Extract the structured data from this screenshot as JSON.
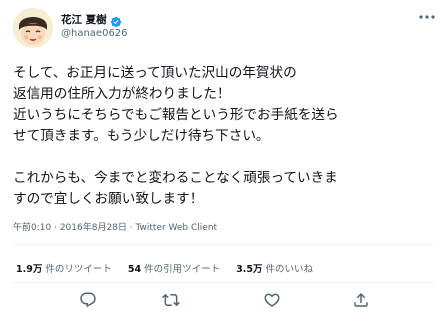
{
  "user": {
    "display_name": "花江 夏樹",
    "handle": "@hanae0626",
    "verified": true
  },
  "tweet": {
    "lines": [
      "そして、お正月に送って頂いた沢山の年賀状の",
      "返信用の住所入力が終わりました！",
      "近いうちにそちらでもご報告という形でお手紙を送ら",
      "せて頂きます。もう少しだけ待ち下さい。",
      "",
      "これからも、今までと変わることなく頑張っていきま",
      "すので宜しくお願い致します！"
    ]
  },
  "meta": {
    "time": "午前0:10",
    "separator": " · ",
    "date": "2016年8月28日",
    "client": "Twitter Web Client"
  },
  "stats": {
    "retweets_num": "1.9万",
    "retweets_label": "件のリツイート",
    "quotes_num": "54",
    "quotes_label": "件の引用ツイート",
    "likes_num": "3.5万",
    "likes_label": "件のいいね"
  },
  "icons": {
    "more": "more-icon",
    "verified": "verified-badge-icon",
    "reply": "reply-icon",
    "retweet": "retweet-icon",
    "like": "like-icon",
    "share": "share-icon"
  },
  "colors": {
    "verified": "#1d9bf0",
    "secondary_text": "#536471",
    "primary_text": "#0f1419",
    "divider": "#eff3f4"
  }
}
